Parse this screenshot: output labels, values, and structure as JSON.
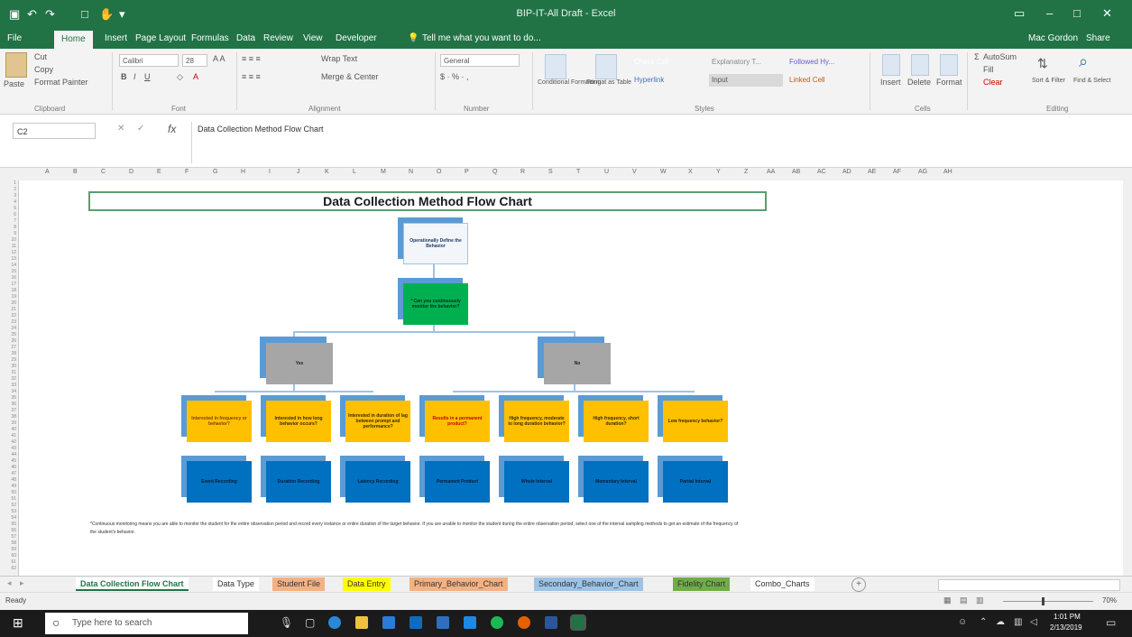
{
  "window": {
    "title": "BIP-IT-All Draft - Excel",
    "user": "Mac Gordon",
    "share": "Share"
  },
  "ribbon_tabs": [
    "File",
    "Home",
    "Insert",
    "Page Layout",
    "Formulas",
    "Data",
    "Review",
    "View",
    "Developer"
  ],
  "tell_me": "Tell me what you want to do...",
  "ribbon": {
    "clipboard": {
      "paste": "Paste",
      "cut": "Cut",
      "copy": "Copy",
      "format_painter": "Format Painter",
      "group": "Clipboard"
    },
    "font": {
      "name": "Calibri",
      "size": "28",
      "group": "Font"
    },
    "alignment": {
      "wrap": "Wrap Text",
      "merge": "Merge & Center",
      "group": "Alignment"
    },
    "number": {
      "format": "General",
      "group": "Number"
    },
    "styles": {
      "cond": "Conditional Formatting",
      "table": "Format as Table",
      "group": "Styles",
      "cells": [
        {
          "label": "Check Cell",
          "color": "#a5a5a5"
        },
        {
          "label": "Explanatory T...",
          "color": "#f3f3f3"
        },
        {
          "label": "Followed Hy...",
          "color": "#f3f3f3"
        },
        {
          "label": "Hyperlink",
          "color": "#f3f3f3"
        },
        {
          "label": "Input",
          "color": "#d9d9d9"
        },
        {
          "label": "Linked Cell",
          "color": "#f3f3f3"
        }
      ]
    },
    "cells": {
      "insert": "Insert",
      "delete": "Delete",
      "format": "Format",
      "group": "Cells"
    },
    "editing": {
      "autosum": "AutoSum",
      "fill": "Fill",
      "clear": "Clear",
      "sort": "Sort & Filter",
      "find": "Find & Select",
      "group": "Editing"
    }
  },
  "formula_bar": {
    "name_box": "C2",
    "formula": "Data Collection Method Flow Chart"
  },
  "columns": [
    "A",
    "B",
    "C",
    "D",
    "E",
    "F",
    "G",
    "H",
    "I",
    "J",
    "K",
    "L",
    "M",
    "N",
    "O",
    "P",
    "Q",
    "R",
    "S",
    "T",
    "U",
    "V",
    "W",
    "X",
    "Y",
    "Z",
    "AA",
    "AB",
    "AC",
    "AD",
    "AE",
    "AF",
    "AG",
    "AH"
  ],
  "chart": {
    "title": "Data Collection Method Flow Chart",
    "nodes": {
      "root": "Operationally Define the Behavior",
      "question": "* Can you continuously monitor the behavior?",
      "yes": "Yes",
      "no": "No",
      "q1": "Interested in frequency or behavior?",
      "q2": "Interested in how long behavior occurs?",
      "q3": "Interested in duration of lag between prompt and performance?",
      "q4": "Results in a permanent product?",
      "q5": "High frequency, moderate to long duration behavior?",
      "q6": "High frequency, short duration?",
      "q7": "Low frequency behavior?",
      "a1": "Event Recording",
      "a2": "Duration Recording",
      "a3": "Latency Recording",
      "a4": "Permanent Product",
      "a5": "Whole Interval",
      "a6": "Momentary Interval",
      "a7": "Partial Interval"
    },
    "note": "*Continuous monitoring means you are able to monitor the student for the entire observation period and record every instance or entire duration of the target behavior. If you are unable to monitor the student during the entire observation period, select one of the interval sampling methods to get an estimate of the frequency of the student's behavior."
  },
  "sheet_tabs": [
    {
      "label": "Data Collection Flow Chart",
      "color": "#ffffff",
      "text": "#217346"
    },
    {
      "label": "Data Type",
      "color": "#ffffff",
      "text": "#333333"
    },
    {
      "label": "Student File",
      "color": "#f4b183",
      "text": "#333333"
    },
    {
      "label": "Data Entry",
      "color": "#ffff00",
      "text": "#333333"
    },
    {
      "label": "Primary_Behavior_Chart",
      "color": "#f4b183",
      "text": "#333333"
    },
    {
      "label": "Secondary_Behavior_Chart",
      "color": "#9dc3e6",
      "text": "#333333"
    },
    {
      "label": "Fidelity Chart",
      "color": "#70ad47",
      "text": "#333333"
    },
    {
      "label": "Combo_Charts",
      "color": "#ffffff",
      "text": "#333333"
    }
  ],
  "status": {
    "ready": "Ready",
    "zoom": "70%"
  },
  "taskbar": {
    "search_placeholder": "Type here to search",
    "time": "1:01 PM",
    "date": "2/13/2019"
  },
  "colors": {
    "excel_green": "#217346",
    "node_blue": "#0070c0",
    "node_orange": "#ffc000",
    "node_gray": "#a6a6a6",
    "node_green": "#00b050"
  }
}
